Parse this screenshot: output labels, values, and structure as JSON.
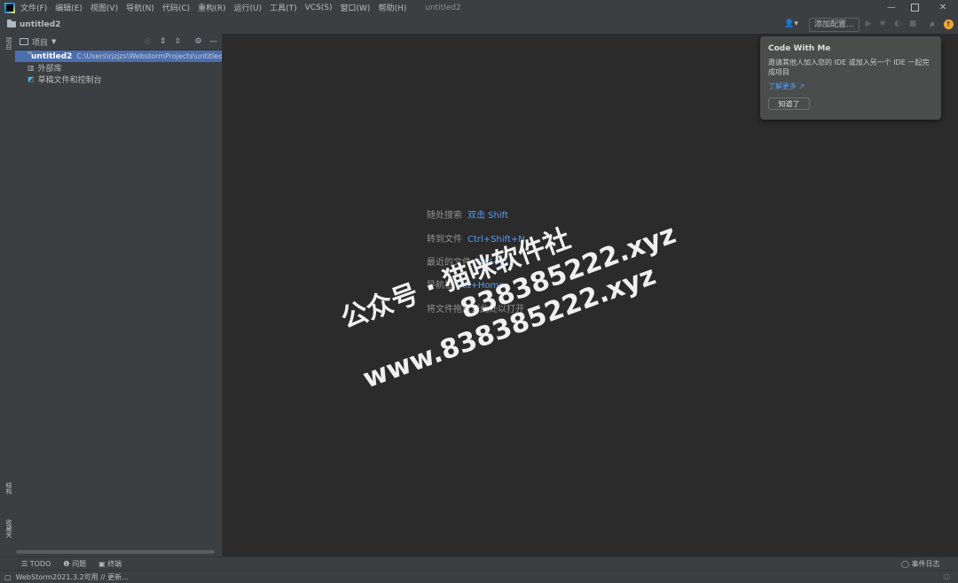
{
  "menu": [
    "文件(F)",
    "编辑(E)",
    "视图(V)",
    "导航(N)",
    "代码(C)",
    "重构(R)",
    "运行(U)",
    "工具(T)",
    "VCS(S)",
    "窗口(W)",
    "帮助(H)"
  ],
  "window_title": "untitled2",
  "breadcrumb": "untitled2",
  "toolbar": {
    "add_config": "添加配置..."
  },
  "left_tabs": {
    "project": "项目",
    "structure": "结构",
    "favorites": "收藏夹"
  },
  "panel": {
    "title": "项目"
  },
  "tree": [
    {
      "label": "untitled2",
      "path": "C:\\Users\\rjzjzs\\WebstormProjects\\untitled"
    },
    {
      "label": "外部库"
    },
    {
      "label": "草稿文件和控制台"
    }
  ],
  "hints": [
    {
      "text": "随处搜索",
      "key": "双击 Shift"
    },
    {
      "text": "转到文件",
      "key": "Ctrl+Shift+N"
    },
    {
      "text": "最近的文件",
      "key": "Ctrl+E"
    },
    {
      "text": "导航栏",
      "key": "Alt+Home"
    },
    {
      "text": "将文件拖放到此处以打开",
      "key": ""
    }
  ],
  "popup": {
    "title": "Code With Me",
    "body": "邀请其他人加入您的 IDE 或加入另一个 IDE 一起完成项目",
    "link": "了解更多 ↗",
    "button": "知道了"
  },
  "bottom_tabs": [
    "TODO",
    "问题",
    "终端"
  ],
  "event_log": "事件日志",
  "status": "WebStorm2021.3.2可用 // 更新...",
  "watermark": {
    "line1": "公众号 · 猫咪软件社",
    "line2": "838385222.xyz",
    "line3": "www.838385222.xyz"
  },
  "colors": {
    "accent": "#589df6",
    "selection": "#4b6eaf",
    "notification": "#f0a732"
  }
}
